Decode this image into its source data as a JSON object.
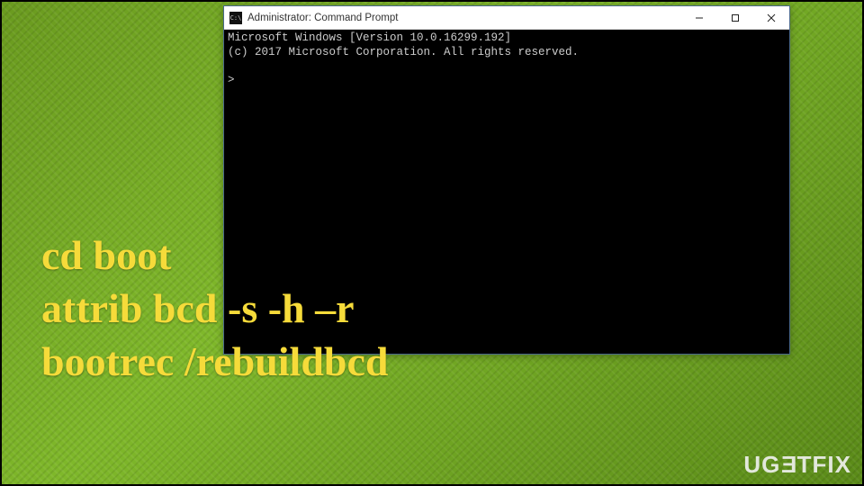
{
  "window": {
    "title": "Administrator: Command Prompt",
    "icon_label": "C:\\"
  },
  "terminal": {
    "line1": "Microsoft Windows [Version 10.0.16299.192]",
    "line2": "(c) 2017 Microsoft Corporation. All rights reserved.",
    "prompt": ">"
  },
  "overlay": {
    "cmd1": "cd boot",
    "cmd2": "attrib bcd -s -h –r",
    "cmd3": "bootrec /rebuildbcd"
  },
  "watermark": {
    "part1": "UG",
    "part2_rotated": "E",
    "part3": "TFIX"
  }
}
